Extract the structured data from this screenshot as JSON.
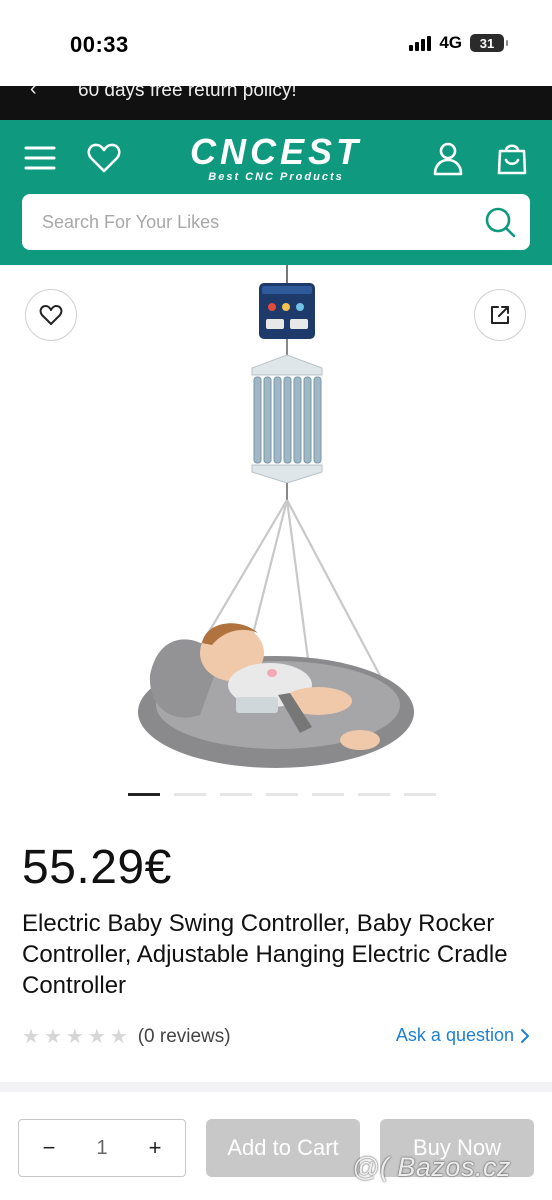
{
  "status": {
    "time": "00:33",
    "network": "4G",
    "battery": "31"
  },
  "promo": {
    "text": "60 days free return policy!"
  },
  "header": {
    "logo_main": "CNCEST",
    "logo_sub": "Best CNC Products",
    "search_placeholder": "Search For Your Likes"
  },
  "gallery": {
    "slide_count": 7,
    "active_slide": 1
  },
  "product": {
    "price": "55.29€",
    "title": "Electric Baby Swing Controller, Baby Rocker Controller, Adjustable Hanging Electric Cradle Controller",
    "rating": 0,
    "reviews": "(0 reviews)",
    "ask_link": "Ask a question"
  },
  "cart": {
    "minus": "−",
    "quantity": "1",
    "plus": "+",
    "add_to_cart": "Add to Cart",
    "buy_now": "Buy Now"
  },
  "watermark": "@( Bazos.cz",
  "colors": {
    "brand_green": "#0f9a80",
    "link_blue": "#1f7fd1",
    "disabled_gray": "#c8c8c8"
  }
}
